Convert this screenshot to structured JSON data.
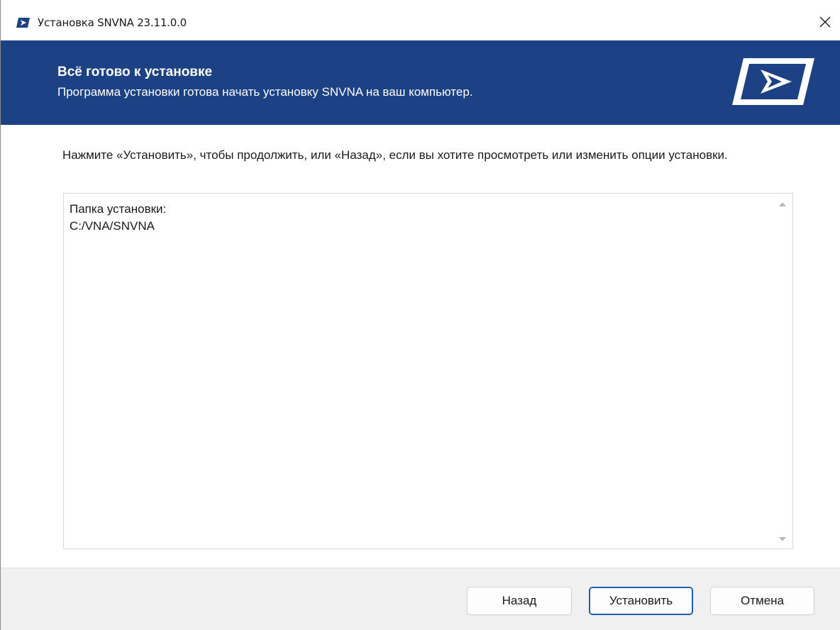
{
  "window": {
    "title": "Установка SNVNA 23.11.0.0",
    "close_icon": "close-icon",
    "app_icon": "snvna-logo-icon"
  },
  "banner": {
    "title": "Всё готово к установке",
    "subtitle": "Программа установки готова начать установку SNVNA на ваш компьютер.",
    "background_color": "#1c4285",
    "logo_icon": "snvna-logo-icon"
  },
  "main": {
    "instruction": "Нажмите «Установить», чтобы продолжить, или «Назад», если вы хотите просмотреть или изменить опции установки.",
    "summary": {
      "lines": [
        "Папка установки:",
        "C:/VNA/SNVNA"
      ]
    }
  },
  "footer": {
    "back_label": "Назад",
    "install_label": "Установить",
    "cancel_label": "Отмена",
    "accent_color": "#1a5fb4"
  }
}
